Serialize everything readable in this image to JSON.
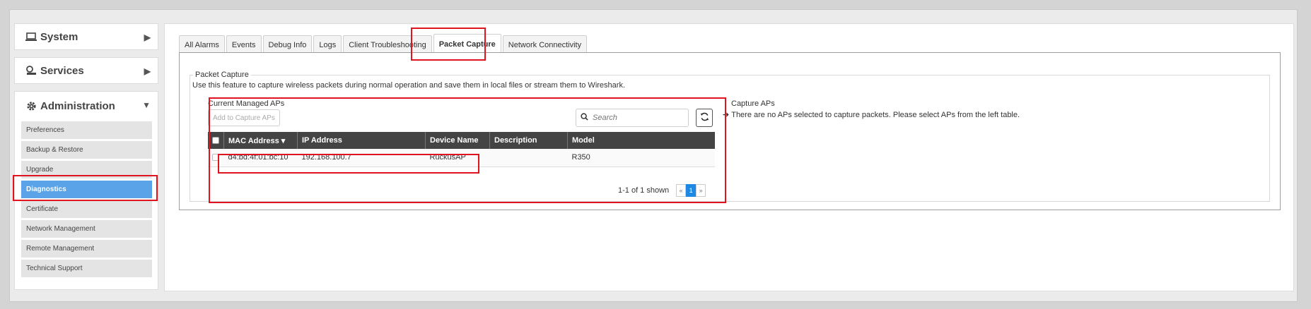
{
  "sidebar": {
    "system": {
      "label": "System"
    },
    "services": {
      "label": "Services"
    },
    "administration": {
      "label": "Administration",
      "items": [
        {
          "label": "Preferences"
        },
        {
          "label": "Backup & Restore"
        },
        {
          "label": "Upgrade"
        },
        {
          "label": "Diagnostics"
        },
        {
          "label": "Certificate"
        },
        {
          "label": "Network Management"
        },
        {
          "label": "Remote Management"
        },
        {
          "label": "Technical Support"
        }
      ],
      "active": "Diagnostics"
    }
  },
  "tabs": [
    {
      "label": "All Alarms"
    },
    {
      "label": "Events"
    },
    {
      "label": "Debug Info"
    },
    {
      "label": "Logs"
    },
    {
      "label": "Client Troubleshooting"
    },
    {
      "label": "Packet Capture"
    },
    {
      "label": "Network Connectivity"
    }
  ],
  "active_tab": "Packet Capture",
  "packet_capture": {
    "legend": "Packet Capture",
    "intro": "Use this feature to capture wireless packets during normal operation and save them in local files or stream them to Wireshark.",
    "managed_aps": {
      "title": "Current Managed APs",
      "add_button": "Add to Capture APs",
      "search_placeholder": "Search",
      "columns": [
        "MAC Address",
        "IP Address",
        "Device Name",
        "Description",
        "Model"
      ],
      "sort_indicator": "▾",
      "rows": [
        {
          "mac": "d4:bd:4f:01:bc:10",
          "ip": "192.168.100.7",
          "device_name": "RuckusAP",
          "description": "",
          "model": "R350"
        }
      ],
      "shown_text": "1-1 of 1 shown",
      "pager": {
        "prev": "«",
        "current": "1",
        "next": "»"
      }
    },
    "capture_aps": {
      "title": "Capture APs",
      "message": "There are no APs selected to capture packets. Please select APs from the left table."
    }
  },
  "colors": {
    "highlight": "#e0141e",
    "active_item": "#5aa3e8",
    "table_header": "#444444",
    "pager_active": "#1e88e5"
  }
}
